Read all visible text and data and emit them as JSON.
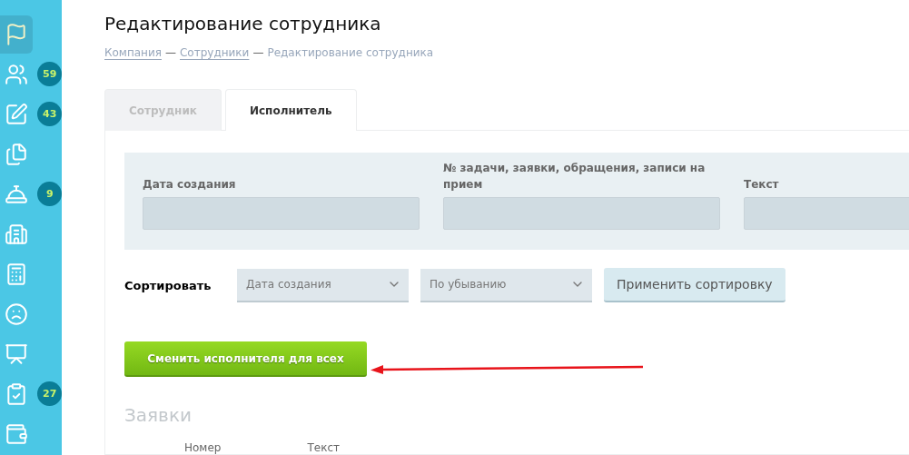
{
  "sidebar": {
    "items": [
      {
        "selected": true
      },
      {
        "selected": false,
        "badge": "59"
      },
      {
        "selected": false,
        "badge": "43"
      },
      {
        "selected": false
      },
      {
        "selected": false,
        "badge": "9"
      },
      {
        "selected": false
      },
      {
        "selected": false
      },
      {
        "selected": false
      },
      {
        "selected": false
      },
      {
        "selected": false,
        "badge": "27"
      },
      {
        "selected": false
      }
    ]
  },
  "title": "Редактирование сотрудника",
  "breadcrumb_separator": "—",
  "breadcrumbs": [
    {
      "label": "Компания",
      "link": true
    },
    {
      "label": "Сотрудники",
      "link": true
    },
    {
      "label": "Редактирование сотрудника",
      "link": false
    }
  ],
  "tabs": [
    {
      "label": "Сотрудник",
      "selected": false
    },
    {
      "label": "Исполнитель",
      "selected": true
    }
  ],
  "filters": [
    {
      "label": "Дата создания"
    },
    {
      "label": "№ задачи, заявки, обращения, записи на прием"
    },
    {
      "label": "Текст"
    }
  ],
  "sort": {
    "label": "Сортировать",
    "field": "Дата создания",
    "order": "По убыванию",
    "apply": "Применить сортировку"
  },
  "change_all_button": "Сменить исполнителя для всех",
  "section_title": "Заявки",
  "table": {
    "columns": [
      "Номер",
      "Текст"
    ]
  }
}
